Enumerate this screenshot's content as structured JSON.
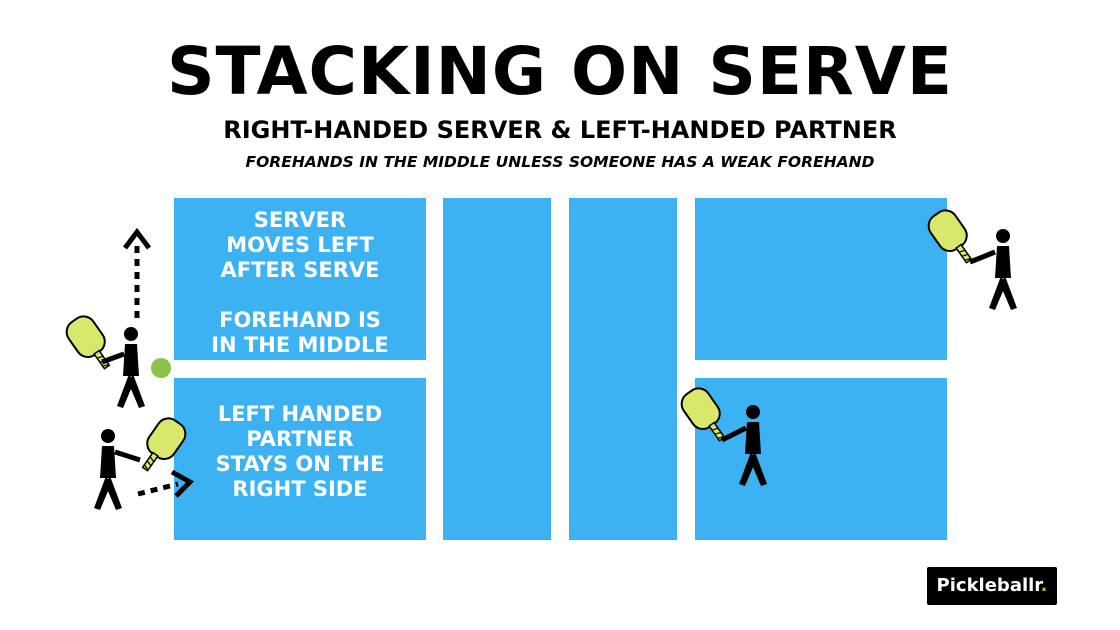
{
  "header": {
    "title": "STACKING ON SERVE",
    "subtitle": "RIGHT-HANDED  SERVER & LEFT-HANDED PARTNER",
    "tagline": "FOREHANDS IN THE MIDDLE UNLESS SOMEONE HAS A WEAK FOREHAND"
  },
  "court_notes": {
    "server_note": "SERVER\nMOVES LEFT\nAFTER  SERVE\n\nFOREHAND IS\nIN THE MIDDLE",
    "partner_note": "LEFT HANDED\nPARTNER\nSTAYS ON THE\nRIGHT SIDE"
  },
  "colors": {
    "court": "#3db2f3",
    "paddle": "#d9e86b",
    "ball": "#8bc34a",
    "figure": "#000000"
  },
  "icons": [
    "arrow-up-icon",
    "arrow-right-icon",
    "player-icon",
    "paddle-icon",
    "ball-icon"
  ],
  "brand": {
    "logo_text": "Pickleballr",
    "logo_dot": "."
  }
}
